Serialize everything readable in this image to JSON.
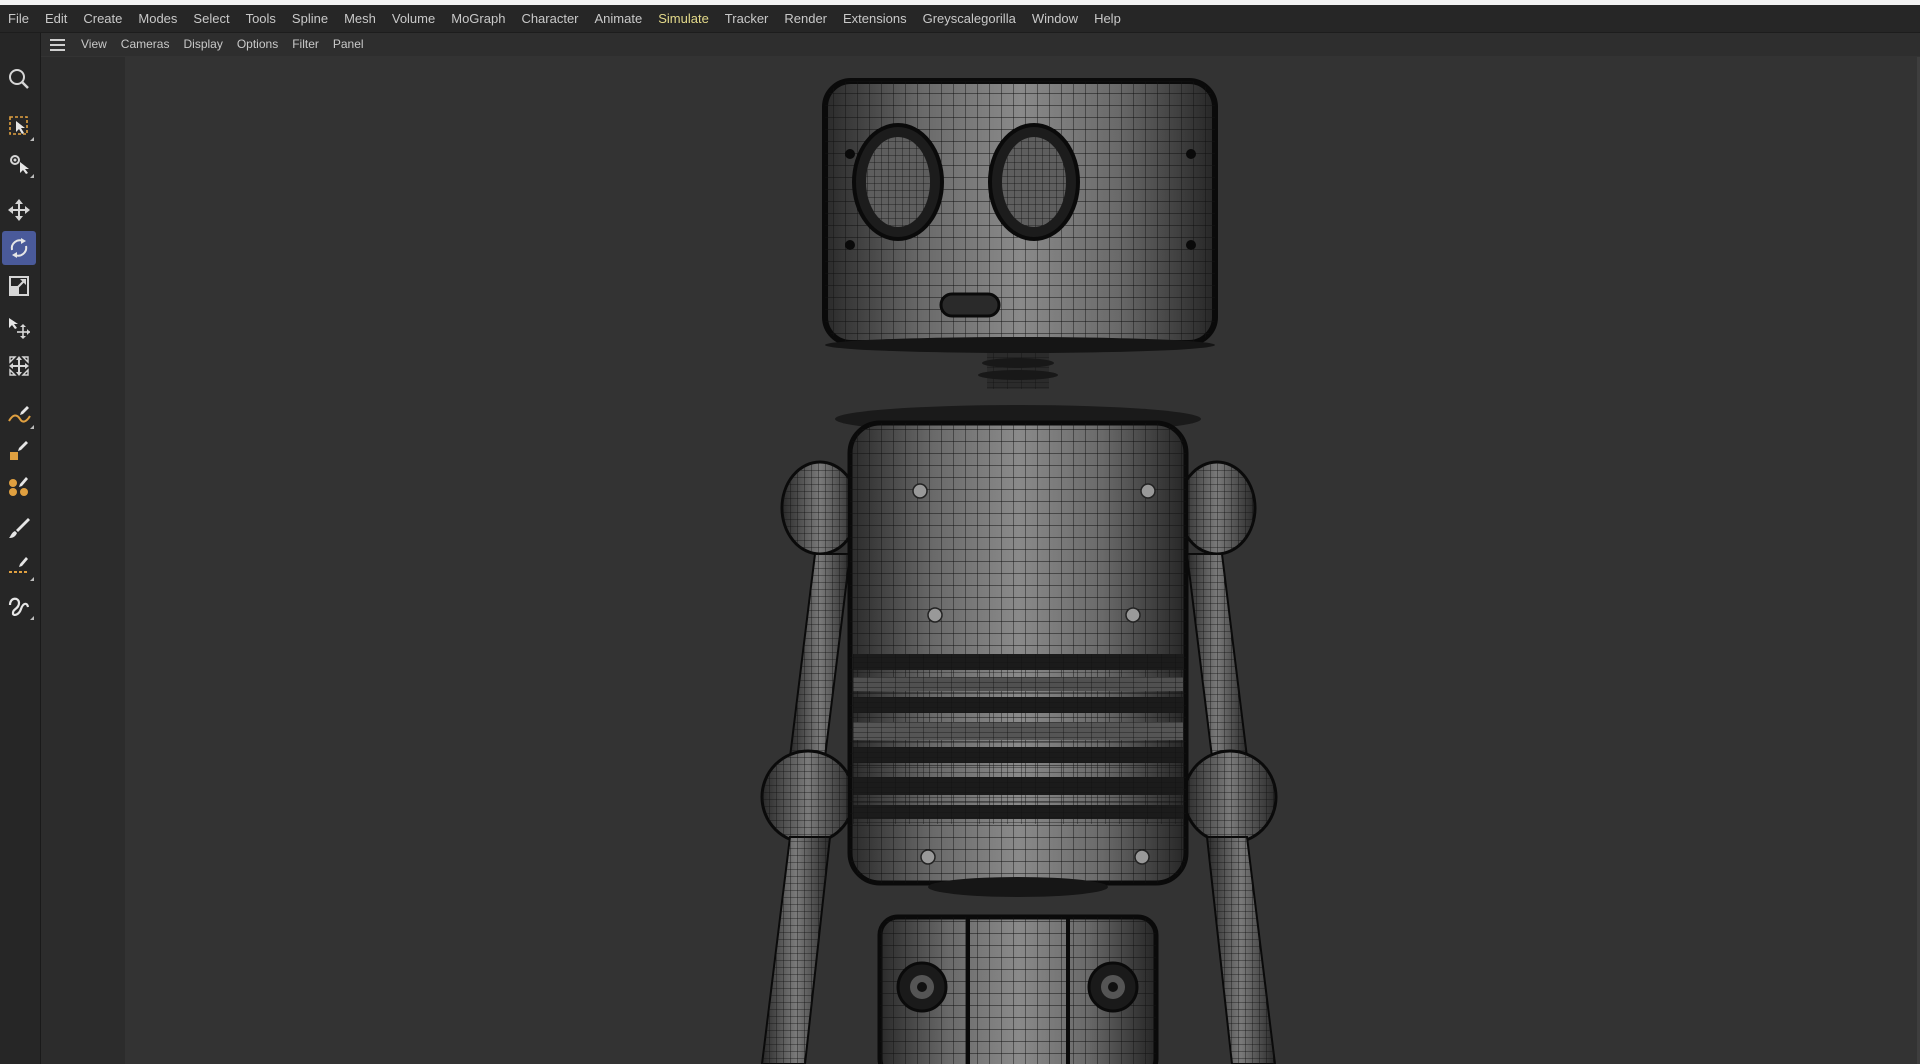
{
  "menu": [
    "File",
    "Edit",
    "Create",
    "Modes",
    "Select",
    "Tools",
    "Spline",
    "Mesh",
    "Volume",
    "MoGraph",
    "Character",
    "Animate",
    "Simulate",
    "Tracker",
    "Render",
    "Extensions",
    "Greyscalegorilla",
    "Window",
    "Help"
  ],
  "menu_active": "Simulate",
  "viewport_menu": [
    "View",
    "Cameras",
    "Display",
    "Options",
    "Filter",
    "Panel"
  ],
  "tools": [
    {
      "name": "search-icon"
    },
    {
      "name": "live-selection-icon"
    },
    {
      "name": "tweak-move-icon"
    },
    {
      "name": "move-icon"
    },
    {
      "name": "rotate-icon",
      "active": true
    },
    {
      "name": "scale-icon"
    },
    {
      "name": "transform-icon"
    },
    {
      "name": "multi-transform-icon"
    },
    {
      "name": "spline-pen-icon"
    },
    {
      "name": "spline-sketch-icon"
    },
    {
      "name": "spline-boolean-icon"
    },
    {
      "name": "brush-icon"
    },
    {
      "name": "knife-icon"
    },
    {
      "name": "spline-smooth-icon"
    }
  ],
  "colors": {
    "accent_active_menu": "#e3d98a",
    "tool_active_bg": "#4a5a9a",
    "viewport_bg": "#333333",
    "wire": "#0d0d0d",
    "shade": "#7a7a7a"
  }
}
